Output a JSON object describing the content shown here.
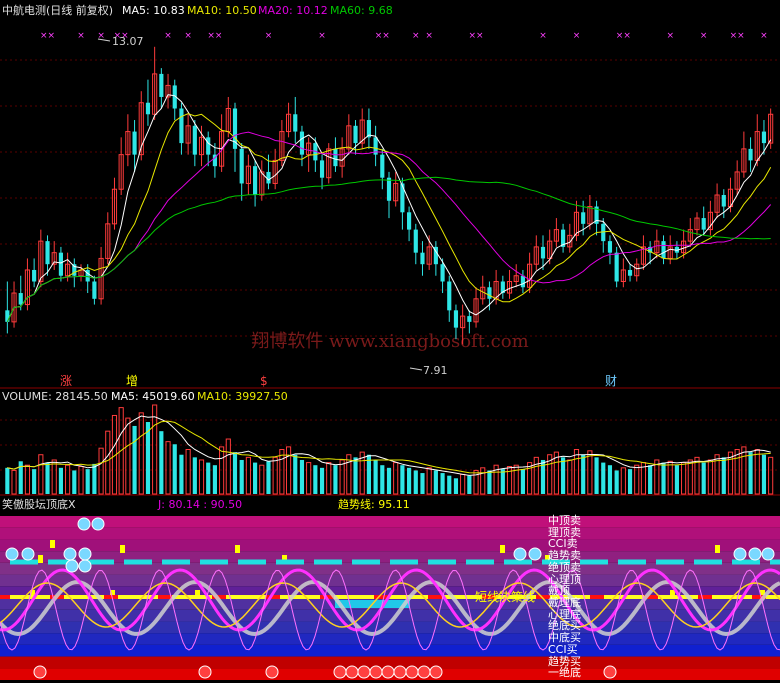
{
  "price_header": {
    "title": "中航电测(日线 前复权)",
    "ma5": "MA5: 10.83",
    "ma10": "MA10: 10.50",
    "ma20": "MA20: 10.12",
    "ma60": "MA60: 9.68"
  },
  "volume_header": {
    "label": "VOLUME: 28145.50",
    "ma5": "MA5: 45019.60",
    "ma10": "MA10: 39927.50"
  },
  "indicator_header": {
    "name": "笑傲股坛顶底X",
    "j": "J: 80.14 : 90.50",
    "trend": "趋势线: 95.11"
  },
  "watermark": "翔博软件 www.xiangbosoft.com",
  "markers": {
    "high": "13.07",
    "low": "7.91",
    "events": [
      "涨",
      "增",
      "$",
      "财"
    ]
  },
  "band_labels": [
    "中顶卖",
    "理顶卖",
    "CCI卖",
    "趋势卖",
    "绝顶卖",
    "心理顶",
    "戴顶",
    "戴理底",
    "心理底",
    "绝底买",
    "中底买",
    "CCI买",
    "趋势买",
    "一绝底"
  ],
  "strategy_label": "短线决策线",
  "colors": {
    "up": "#ff3b3b",
    "down": "#2ee6e6",
    "ma5": "#ffffff",
    "ma10": "#e8e800",
    "ma20": "#e000e0",
    "ma60": "#00c800"
  },
  "chart_data": {
    "type": "candlestick",
    "candles": [
      [
        8.5,
        8.3,
        9.0,
        8.1
      ],
      [
        8.3,
        8.8,
        9.0,
        8.2
      ],
      [
        8.8,
        8.6,
        9.1,
        8.5
      ],
      [
        8.6,
        9.2,
        9.4,
        8.5
      ],
      [
        9.2,
        9.0,
        9.4,
        8.9
      ],
      [
        9.0,
        9.7,
        9.9,
        8.9
      ],
      [
        9.7,
        9.3,
        9.8,
        9.1
      ],
      [
        9.3,
        9.5,
        9.7,
        9.2
      ],
      [
        9.5,
        9.1,
        9.6,
        9.0
      ],
      [
        9.1,
        9.3,
        9.5,
        9.0
      ],
      [
        9.3,
        9.1,
        9.4,
        8.9
      ],
      [
        9.1,
        9.2,
        9.3,
        9.0
      ],
      [
        9.2,
        9.0,
        9.3,
        8.8
      ],
      [
        9.0,
        8.7,
        9.1,
        8.6
      ],
      [
        8.7,
        9.4,
        9.6,
        8.6
      ],
      [
        9.4,
        10.0,
        10.2,
        9.3
      ],
      [
        10.0,
        10.6,
        10.8,
        9.9
      ],
      [
        10.6,
        11.2,
        11.5,
        10.5
      ],
      [
        11.2,
        11.6,
        11.9,
        11.0
      ],
      [
        11.6,
        11.2,
        11.8,
        10.9
      ],
      [
        11.2,
        12.1,
        12.3,
        11.1
      ],
      [
        12.1,
        11.9,
        12.5,
        11.7
      ],
      [
        11.9,
        12.6,
        13.07,
        11.8
      ],
      [
        12.6,
        12.2,
        12.7,
        12.0
      ],
      [
        12.2,
        12.4,
        12.6,
        12.0
      ],
      [
        12.4,
        12.0,
        12.5,
        11.8
      ],
      [
        12.0,
        11.4,
        12.1,
        11.2
      ],
      [
        11.4,
        11.7,
        11.9,
        11.2
      ],
      [
        11.7,
        11.2,
        11.8,
        11.0
      ],
      [
        11.2,
        11.5,
        11.7,
        11.0
      ],
      [
        11.5,
        11.2,
        11.6,
        11.0
      ],
      [
        11.2,
        11.0,
        11.4,
        10.8
      ],
      [
        11.0,
        11.6,
        11.9,
        10.9
      ],
      [
        11.6,
        12.0,
        12.2,
        11.5
      ],
      [
        12.0,
        11.3,
        12.1,
        10.9
      ],
      [
        11.3,
        10.7,
        11.4,
        10.4
      ],
      [
        10.7,
        11.0,
        11.2,
        10.5
      ],
      [
        11.0,
        10.5,
        11.1,
        10.3
      ],
      [
        10.5,
        10.9,
        11.1,
        10.4
      ],
      [
        10.9,
        10.7,
        11.2,
        10.6
      ],
      [
        10.7,
        11.1,
        11.3,
        10.6
      ],
      [
        11.1,
        11.6,
        11.8,
        11.0
      ],
      [
        11.6,
        11.9,
        12.1,
        11.5
      ],
      [
        11.9,
        11.6,
        12.2,
        11.4
      ],
      [
        11.6,
        11.2,
        11.7,
        11.0
      ],
      [
        11.2,
        11.4,
        11.5,
        10.9
      ],
      [
        11.4,
        11.1,
        11.5,
        10.9
      ],
      [
        11.1,
        10.8,
        11.2,
        10.6
      ],
      [
        10.8,
        11.3,
        11.4,
        10.7
      ],
      [
        11.3,
        11.0,
        11.5,
        10.9
      ],
      [
        11.0,
        11.3,
        11.5,
        10.8
      ],
      [
        11.3,
        11.7,
        11.9,
        11.2
      ],
      [
        11.7,
        11.4,
        11.8,
        11.2
      ],
      [
        11.4,
        11.8,
        12.0,
        11.3
      ],
      [
        11.8,
        11.5,
        12.0,
        11.3
      ],
      [
        11.5,
        11.2,
        11.7,
        11.0
      ],
      [
        11.2,
        10.8,
        11.3,
        10.6
      ],
      [
        10.8,
        10.4,
        10.9,
        10.1
      ],
      [
        10.4,
        10.7,
        10.9,
        10.3
      ],
      [
        10.7,
        10.2,
        10.8,
        9.9
      ],
      [
        10.2,
        9.9,
        10.3,
        9.7
      ],
      [
        9.9,
        9.5,
        10.0,
        9.3
      ],
      [
        9.5,
        9.3,
        9.7,
        9.1
      ],
      [
        9.3,
        9.6,
        9.8,
        9.2
      ],
      [
        9.6,
        9.3,
        9.7,
        9.1
      ],
      [
        9.3,
        9.0,
        9.4,
        8.8
      ],
      [
        9.0,
        8.5,
        9.1,
        8.3
      ],
      [
        8.5,
        8.2,
        8.6,
        8.0
      ],
      [
        8.2,
        8.4,
        8.6,
        7.91
      ],
      [
        8.4,
        8.3,
        8.5,
        8.1
      ],
      [
        8.3,
        8.7,
        8.9,
        8.2
      ],
      [
        8.7,
        8.9,
        9.1,
        8.6
      ],
      [
        8.9,
        8.7,
        9.0,
        8.5
      ],
      [
        8.7,
        9.0,
        9.2,
        8.6
      ],
      [
        9.0,
        8.8,
        9.1,
        8.7
      ],
      [
        8.8,
        9.0,
        9.2,
        8.7
      ],
      [
        9.0,
        9.1,
        9.3,
        8.9
      ],
      [
        9.1,
        8.9,
        9.2,
        8.8
      ],
      [
        8.9,
        9.3,
        9.5,
        8.8
      ],
      [
        9.3,
        9.6,
        9.8,
        9.2
      ],
      [
        9.6,
        9.4,
        9.8,
        9.2
      ],
      [
        9.4,
        9.7,
        9.9,
        9.3
      ],
      [
        9.7,
        9.9,
        10.1,
        9.6
      ],
      [
        9.9,
        9.6,
        10.0,
        9.5
      ],
      [
        9.6,
        9.8,
        10.0,
        9.5
      ],
      [
        9.8,
        10.2,
        10.4,
        9.7
      ],
      [
        10.2,
        10.0,
        10.4,
        9.8
      ],
      [
        10.0,
        10.3,
        10.5,
        9.9
      ],
      [
        10.3,
        10.0,
        10.4,
        9.8
      ],
      [
        10.0,
        9.7,
        10.1,
        9.5
      ],
      [
        9.7,
        9.5,
        9.8,
        9.3
      ],
      [
        9.5,
        9.0,
        9.6,
        8.9
      ],
      [
        9.0,
        9.2,
        9.4,
        8.9
      ],
      [
        9.2,
        9.1,
        9.3,
        9.0
      ],
      [
        9.1,
        9.3,
        9.4,
        9.0
      ],
      [
        9.3,
        9.6,
        9.8,
        9.2
      ],
      [
        9.6,
        9.5,
        9.7,
        9.3
      ],
      [
        9.5,
        9.7,
        9.9,
        9.4
      ],
      [
        9.7,
        9.4,
        9.8,
        9.3
      ],
      [
        9.4,
        9.6,
        9.8,
        9.3
      ],
      [
        9.6,
        9.5,
        9.7,
        9.4
      ],
      [
        9.5,
        9.7,
        9.9,
        9.4
      ],
      [
        9.7,
        9.9,
        10.1,
        9.6
      ],
      [
        9.9,
        10.1,
        10.2,
        9.8
      ],
      [
        10.1,
        9.9,
        10.3,
        9.8
      ],
      [
        9.9,
        10.2,
        10.4,
        9.8
      ],
      [
        10.2,
        10.5,
        10.7,
        10.1
      ],
      [
        10.5,
        10.3,
        10.6,
        10.1
      ],
      [
        10.3,
        10.6,
        10.8,
        10.2
      ],
      [
        10.6,
        10.9,
        11.1,
        10.5
      ],
      [
        10.9,
        11.3,
        11.6,
        10.8
      ],
      [
        11.3,
        11.1,
        11.5,
        10.9
      ],
      [
        11.1,
        11.6,
        11.9,
        11.0
      ],
      [
        11.6,
        11.4,
        11.8,
        11.2
      ],
      [
        11.4,
        11.9,
        12.0,
        11.3
      ]
    ],
    "volume": [
      20,
      18,
      25,
      22,
      19,
      30,
      24,
      26,
      20,
      22,
      18,
      21,
      19,
      23,
      35,
      48,
      60,
      66,
      58,
      52,
      62,
      55,
      68,
      48,
      40,
      38,
      30,
      34,
      28,
      26,
      24,
      22,
      36,
      42,
      32,
      26,
      28,
      24,
      22,
      25,
      28,
      34,
      36,
      30,
      26,
      24,
      22,
      20,
      24,
      22,
      26,
      30,
      28,
      32,
      30,
      26,
      22,
      20,
      24,
      22,
      20,
      18,
      16,
      20,
      18,
      16,
      14,
      12,
      15,
      14,
      18,
      20,
      18,
      22,
      19,
      21,
      22,
      19,
      24,
      28,
      26,
      30,
      32,
      28,
      26,
      34,
      30,
      33,
      28,
      24,
      22,
      18,
      20,
      19,
      22,
      24,
      22,
      26,
      24,
      25,
      22,
      24,
      26,
      28,
      24,
      26,
      30,
      28,
      32,
      34,
      36,
      32,
      34,
      30,
      28
    ],
    "ylim": [
      7.5,
      13.5
    ]
  }
}
